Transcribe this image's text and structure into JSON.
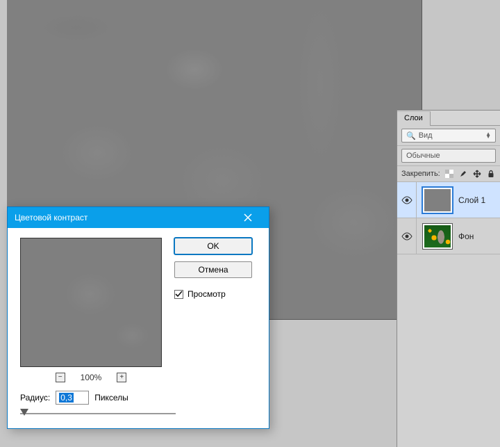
{
  "layers_panel": {
    "tab_label": "Слои",
    "kind_placeholder": "Вид",
    "blend_mode": "Обычные",
    "lock_label": "Закрепить:",
    "layers": [
      {
        "name": "Слой 1",
        "selected": true,
        "photo": false
      },
      {
        "name": "Фон",
        "selected": false,
        "photo": true
      }
    ]
  },
  "dialog": {
    "title": "Цветовой контраст",
    "ok": "OK",
    "cancel": "Отмена",
    "preview_label": "Просмотр",
    "preview_checked": true,
    "zoom": "100%",
    "radius_label": "Радиус:",
    "radius_value": "0,3",
    "radius_unit": "Пикселы"
  }
}
